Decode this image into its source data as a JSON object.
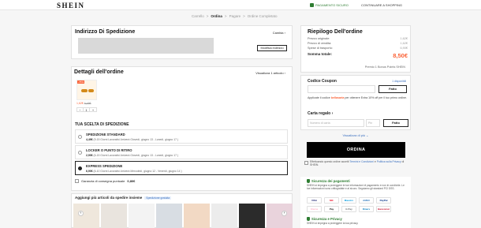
{
  "header": {
    "logo": "SHEIN",
    "secure_label": "PAGAMENTO SICURO",
    "continue_label": "CONTINUARE A SHOPPING"
  },
  "breadcrumb": [
    "Carrello",
    ">",
    "Ordina",
    ">",
    "Pagare",
    ">",
    "Ordine Completato"
  ],
  "address": {
    "title": "Indirizzo Di Spedizione",
    "change_label": "Cambia",
    "edit_button": "Modifica indirizzo"
  },
  "details": {
    "title": "Dettagli dell'ordine",
    "view_all": "Visualizza 1 articolo",
    "product": {
      "discount_tag": "-75%",
      "price": "1,62€",
      "old_price": "6,48€",
      "qty_minus": "−",
      "quantity": "1",
      "qty_plus": "+"
    },
    "shipping_title": "TUA SCELTA DI SPEDIZIONE",
    "shipping_options": [
      {
        "name": "SPEDIZIONE STANDARD",
        "price": "4,49€",
        "desc": "(9-15 Giorni Lavorativi Arriverà Giovedì, giugno 13 - Lunedì, giugno 17 )",
        "selected": false
      },
      {
        "name": "LOCKER O PUNTO DI RITIRO",
        "price": "2,90€",
        "desc": "(6-15 Giorni Lavorativi Arriverà Giovedì, giugno 13 - Lunedì, giugno 17 )",
        "selected": false
      },
      {
        "name": "EXPRESS SPEDIZIONE",
        "price": "6,90€",
        "desc": "(6-10 Giorni Lavorativi Arriverà Mercoledì, giugno 12 - Venerdì, giugno 14 )",
        "selected": true
      }
    ],
    "insurance_text": "Garanzia di consegna puntuale",
    "insurance_price": "0,80€"
  },
  "add_more": {
    "title": "Aggiungi più articoli da spedire insieme",
    "chip": "Spedizione gratuita",
    "prev": "‹",
    "next": "›"
  },
  "summary": {
    "title": "Riepilogo Dell'ordine",
    "rows": [
      {
        "label": "Prezzo originale:",
        "value": "1,62€"
      },
      {
        "label": "Prezzo di vendita:",
        "value": "1,62€"
      },
      {
        "label": "Spese di trasporto:",
        "value": "6,90€"
      }
    ],
    "total_label": "Somma totale:",
    "total_value": "8,50€",
    "points": "Premio 1 Bonus Points SHEIN"
  },
  "coupon": {
    "title": "Codice Coupon",
    "available": "1 disponibili",
    "apply_button": "Fatto",
    "promo_prefix": "Applicate il codice",
    "promo_code": "bellasaria",
    "promo_suffix": "per ottenere Extra 10% off per il tuo primo ordine."
  },
  "gift": {
    "title": "Carta regalo",
    "number_placeholder": "Numero di carta",
    "pin_placeholder": "Pin",
    "apply_button": "Fatto"
  },
  "show_more": "Visualizza di più ⌄",
  "order_button": "ORDINA",
  "terms": {
    "prefix": "Effettuando questo ordine accetti",
    "link1": "Termini e Condizioni",
    "middle": "e",
    "link2": "Politica sulla Privacy",
    "suffix": "di SHEIN."
  },
  "security": {
    "title": "Sicurezza dei pagamenti",
    "text": "SHEIN si impegna a proteggere le tue informazioni di pagamento e non le condivide. Le tue informazioni sono crittografate e al sicuro. Seguiamo gli standard PCI DSS.",
    "cards": [
      {
        "label": "VISA",
        "color": "#1a1f71"
      },
      {
        "label": "MC",
        "color": "#eb001b"
      },
      {
        "label": "Maestro",
        "color": "#0099df"
      },
      {
        "label": "AMEX",
        "color": "#2e77bc"
      },
      {
        "label": "PayPal",
        "color": "#003087"
      },
      {
        "label": "Klarna",
        "color": "#ffb3c7"
      },
      {
        "label": "Pay",
        "color": "#111111"
      },
      {
        "label": "G Pay",
        "color": "#5f6368"
      },
      {
        "label": "Diners",
        "color": "#0079be"
      },
      {
        "label": "Bancomat",
        "color": "#c8102e"
      }
    ]
  },
  "privacy": {
    "title": "Sicurezza e Privacy",
    "text": "SHEIN si impegna a proteggere la tua privacy."
  },
  "colors": {
    "accent": "#fa6338",
    "secure_green": "#2e7d32",
    "link_blue": "#3a6fbf"
  }
}
